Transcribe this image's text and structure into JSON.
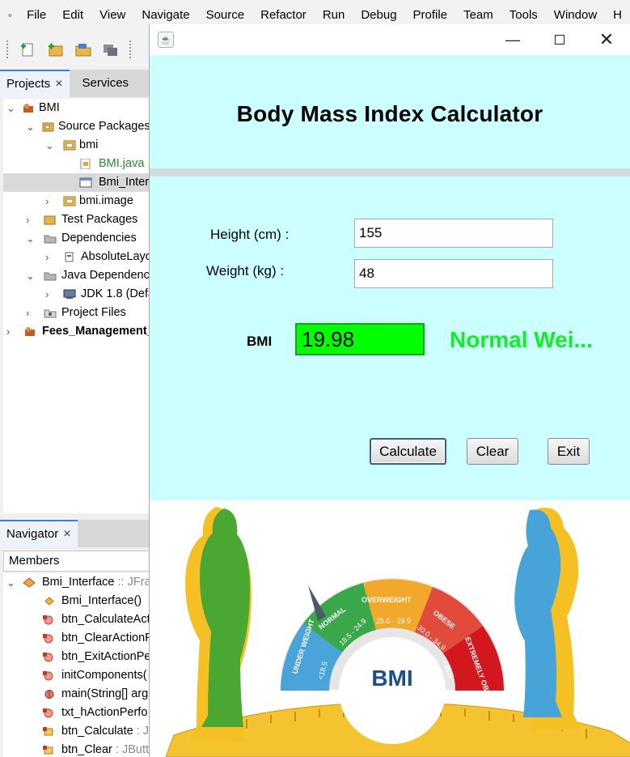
{
  "ide": {
    "menu": [
      "File",
      "Edit",
      "View",
      "Navigate",
      "Source",
      "Refactor",
      "Run",
      "Debug",
      "Profile",
      "Team",
      "Tools",
      "Window",
      "H"
    ],
    "tabs": {
      "projects": "Projects",
      "services": "Services"
    },
    "project_tree": [
      "BMI",
      "Source Packages",
      "bmi",
      "BMI.java",
      "Bmi_Inter",
      "bmi.image",
      "Test Packages",
      "Dependencies",
      "AbsoluteLayo",
      "Java Dependenc",
      "JDK 1.8 (Defa",
      "Project Files",
      "Fees_Management_"
    ],
    "navigator": {
      "tab": "Navigator",
      "filter": "Members",
      "items": [
        {
          "name": "Bmi_Interface",
          "suffix": " :: JFran"
        },
        {
          "name": "Bmi_Interface()",
          "suffix": ""
        },
        {
          "name": "btn_CalculateAct",
          "suffix": ""
        },
        {
          "name": "btn_ClearActionP",
          "suffix": ""
        },
        {
          "name": "btn_ExitActionPe",
          "suffix": ""
        },
        {
          "name": "initComponents(",
          "suffix": ""
        },
        {
          "name": "main(String[] arg",
          "suffix": ""
        },
        {
          "name": "txt_hActionPerfo",
          "suffix": ""
        },
        {
          "name": "btn_Calculate",
          "suffix": " : JB"
        },
        {
          "name": "btn_Clear",
          "suffix": " : JButto"
        }
      ]
    }
  },
  "app": {
    "title": "Body Mass Index Calculator",
    "height_label": "Height (cm) :",
    "height_value": "155",
    "weight_label": "Weight (kg) :",
    "weight_value": "48",
    "bmi_label": "BMI",
    "bmi_value": "19.98",
    "bmi_status": "Normal Wei...",
    "buttons": {
      "calculate": "Calculate",
      "clear": "Clear",
      "exit": "Exit"
    },
    "colors": {
      "background": "#ccffff",
      "bmi_field": "#00ff00",
      "status_text": "#11ee22"
    }
  },
  "gauge": {
    "center_label": "BMI",
    "segments": [
      {
        "name": "UNDER WEIGHT",
        "range": "<18.5",
        "color": "#4aa3d9"
      },
      {
        "name": "NORMAL",
        "range": "18.5 - 24.9",
        "color": "#3aa84a"
      },
      {
        "name": "OVERWEIGHT",
        "range": "25.0 - 29.9",
        "color": "#f2a82b"
      },
      {
        "name": "OBESE",
        "range": "30.0 - 34.9",
        "color": "#e24b3b"
      },
      {
        "name": "EXTREMELY OBESE",
        "range": ">35.0",
        "color": "#d2181e"
      }
    ]
  }
}
